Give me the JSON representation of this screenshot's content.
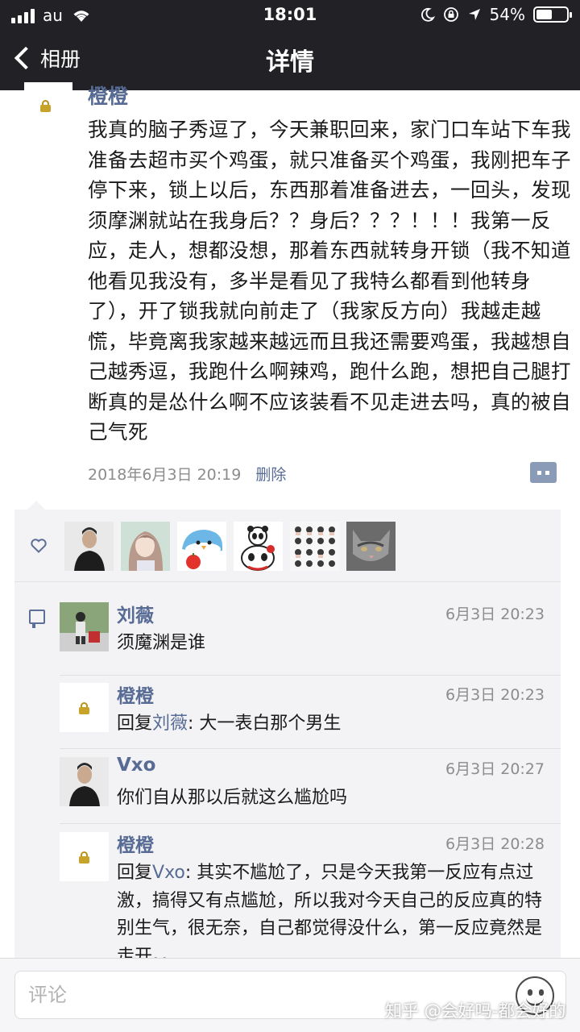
{
  "status_bar": {
    "carrier": "au",
    "time": "18:01",
    "battery": "54%",
    "battery_level": 0.54
  },
  "nav": {
    "back_label": "相册",
    "title": "详情"
  },
  "post": {
    "author": "橙橙",
    "text": "我真的脑子秀逗了，今天兼职回来，家门口车站下车我准备去超市买个鸡蛋，就只准备买个鸡蛋，我刚把车子停下来，锁上以后，东西那着准备进去，一回头，发现须摩渊就站在我身后？？身后？？？！！！我第一反应，走人，想都没想，那着东西就转身开锁（我不知道他看见我没有，多半是看见了我特么都看到他转身了），开了锁我就向前走了（我家反方向）我越走越慌，毕竟离我家越来越远而且我还需要鸡蛋，我越想自己越秀逗，我跑什么啊辣鸡，跑什么跑，想把自己腿打断真的是怂什么啊不应该装看不见走进去吗，真的被自己气死",
    "date": "2018年6月3日 20:19",
    "delete_label": "删除"
  },
  "likes": {
    "avatars": [
      "avatar-man-dark",
      "avatar-anime-girl",
      "avatar-penguin",
      "avatar-panda",
      "avatar-grid-photos",
      "avatar-cat"
    ]
  },
  "comments": [
    {
      "name": "刘薇",
      "time": "6月3日 20:23",
      "text": "须魔渊是谁",
      "avatar": "avatar-person-outdoor"
    },
    {
      "name": "橙橙",
      "time": "6月3日 20:23",
      "reply_prefix": "回复",
      "reply_to": "刘薇",
      "text": ": 大一表白那个男生",
      "avatar": "lock-icon"
    },
    {
      "name": "Vxo",
      "time": "6月3日 20:27",
      "text": "你们自从那以后就这么尴尬吗",
      "avatar": "avatar-man-dark"
    },
    {
      "name": "橙橙",
      "time": "6月3日 20:28",
      "reply_prefix": "回复",
      "reply_to": "Vxo",
      "text": ": 其实不尴尬了，只是今天我第一反应有点过激，搞得又有点尴尬，所以我对今天自己的反应真的特别生气，很无奈，自己都觉得没什么，第一反应竟然是走开。。",
      "avatar": "lock-icon"
    }
  ],
  "input": {
    "placeholder": "评论"
  },
  "watermark": "知乎 @会好吗-都会好的",
  "colors": {
    "link": "#576b95",
    "topbar": "#222226",
    "panel": "#f3f3f5"
  }
}
